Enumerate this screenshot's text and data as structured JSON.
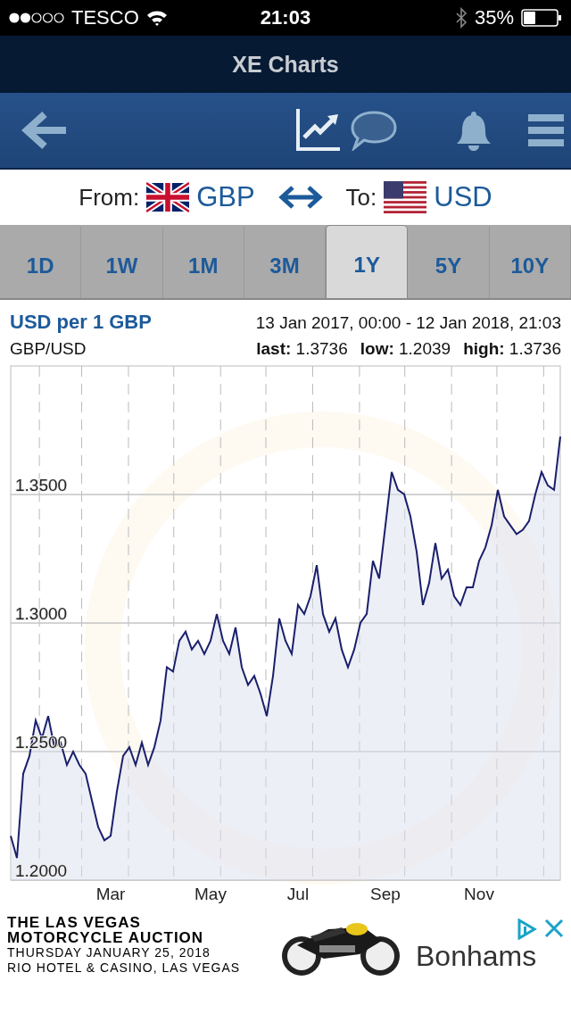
{
  "status_bar": {
    "carrier": "TESCO",
    "time": "21:03",
    "battery": "35%"
  },
  "title_bar": {
    "title": "XE Charts"
  },
  "toolbar": {
    "tools": [
      {
        "kind": "chart",
        "selected": true
      },
      {
        "kind": "comment",
        "selected": false
      }
    ]
  },
  "converter": {
    "from_label": "From:",
    "from_currency": "GBP",
    "to_label": "To:",
    "to_currency": "USD"
  },
  "periods": [
    {
      "label": "1D",
      "selected": false
    },
    {
      "label": "1W",
      "selected": false
    },
    {
      "label": "1M",
      "selected": false
    },
    {
      "label": "3M",
      "selected": false
    },
    {
      "label": "1Y",
      "selected": true
    },
    {
      "label": "5Y",
      "selected": false
    },
    {
      "label": "10Y",
      "selected": false
    }
  ],
  "chart_header": {
    "title": "USD per 1 GBP",
    "range": "13 Jan 2017, 00:00 - 12 Jan 2018, 21:03",
    "pair": "GBP/USD",
    "stats": [
      {
        "label": "last:",
        "value": "1.3736"
      },
      {
        "label": "low:",
        "value": "1.2039"
      },
      {
        "label": "high:",
        "value": "1.3736"
      }
    ]
  },
  "chart_data": {
    "type": "area",
    "grid": true,
    "categories": [
      null,
      null,
      null,
      null,
      null,
      null,
      null,
      null,
      null,
      null,
      null,
      null,
      null,
      null,
      null,
      null,
      "Mar",
      null,
      null,
      null,
      null,
      null,
      null,
      null,
      null,
      null,
      null,
      null,
      null,
      null,
      null,
      null,
      "May",
      null,
      null,
      null,
      null,
      null,
      null,
      null,
      null,
      null,
      null,
      null,
      null,
      null,
      "Jul",
      null,
      null,
      null,
      null,
      null,
      null,
      null,
      null,
      null,
      null,
      null,
      null,
      null,
      "Sep",
      null,
      null,
      null,
      null,
      null,
      null,
      null,
      null,
      null,
      null,
      null,
      null,
      null,
      null,
      "Nov",
      null,
      null,
      null,
      null,
      null,
      null,
      null,
      null,
      null,
      null,
      null,
      null,
      null
    ],
    "series": [
      {
        "color": "#1a1f6b",
        "values": [
          1.2172,
          1.2086,
          1.2414,
          1.2483,
          1.2621,
          1.2552,
          1.2638,
          1.2517,
          1.2535,
          1.2448,
          1.25,
          1.2448,
          1.2414,
          1.231,
          1.2207,
          1.2155,
          1.2172,
          1.2345,
          1.2483,
          1.2517,
          1.2448,
          1.2535,
          1.2448,
          1.2517,
          1.2621,
          1.2828,
          1.2811,
          1.2931,
          1.2966,
          1.2897,
          1.2931,
          1.288,
          1.2931,
          1.3035,
          1.2931,
          1.288,
          1.2983,
          1.2828,
          1.2759,
          1.2794,
          1.2725,
          1.2638,
          1.2794,
          1.3018,
          1.2931,
          1.288,
          1.307,
          1.3035,
          1.3104,
          1.3225,
          1.3035,
          1.2966,
          1.3018,
          1.2897,
          1.2828,
          1.2897,
          1.3001,
          1.3035,
          1.3242,
          1.3173,
          1.338,
          1.3587,
          1.3518,
          1.3501,
          1.3415,
          1.3277,
          1.307,
          1.3156,
          1.3311,
          1.3173,
          1.3208,
          1.3104,
          1.307,
          1.3139,
          1.3139,
          1.3242,
          1.3294,
          1.338,
          1.3518,
          1.3415,
          1.338,
          1.3346,
          1.3363,
          1.3397,
          1.3501,
          1.3587,
          1.3535,
          1.3518,
          1.3725
        ]
      }
    ],
    "ylim": [
      1.2,
      1.4
    ],
    "yticks": [
      {
        "value": 1.2,
        "label": "1.2000"
      },
      {
        "value": 1.25,
        "label": "1.2500"
      },
      {
        "value": 1.3,
        "label": "1.3000"
      },
      {
        "value": 1.35,
        "label": "1.3500"
      }
    ]
  },
  "ad": {
    "lines": [
      {
        "kind": "headline",
        "text": "THE LAS VEGAS"
      },
      {
        "kind": "headline",
        "text": "MOTORCYCLE AUCTION"
      },
      {
        "kind": "detail",
        "text": "THURSDAY JANUARY 25, 2018"
      },
      {
        "kind": "detail",
        "text": "RIO HOTEL & CASINO, LAS VEGAS"
      }
    ],
    "brand": "Bonhams"
  }
}
